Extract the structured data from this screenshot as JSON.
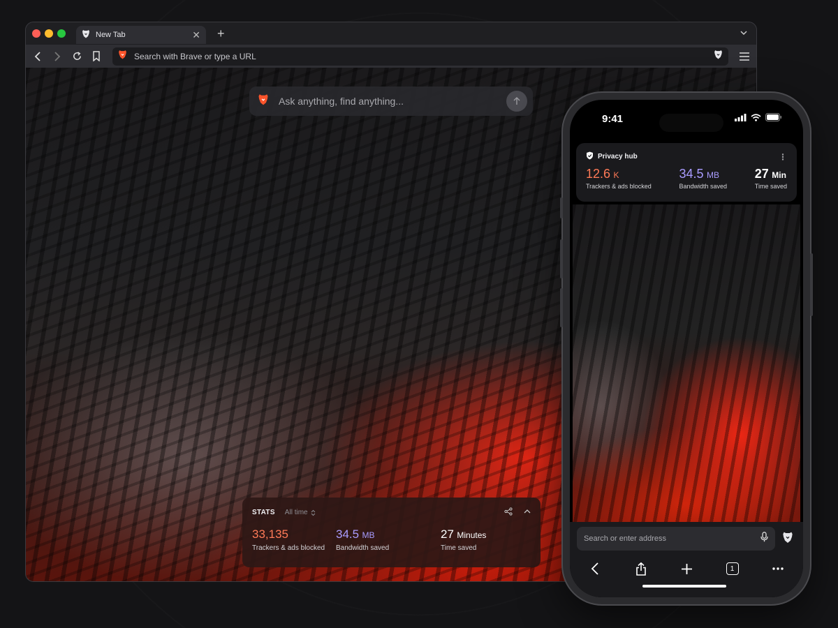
{
  "browser": {
    "tab": {
      "title": "New Tab"
    },
    "urlbar": {
      "placeholder": "Search with Brave or type a URL"
    },
    "ask": {
      "placeholder": "Ask anything, find anything..."
    },
    "stats": {
      "title": "STATS",
      "range": "All time",
      "trackers": {
        "value": "33,135",
        "label": "Trackers & ads blocked"
      },
      "bandwidth": {
        "value": "34.5",
        "unit": "MB",
        "label": "Bandwidth saved"
      },
      "time": {
        "value": "27",
        "unit": "Minutes",
        "label": "Time saved"
      }
    }
  },
  "phone": {
    "status": {
      "time": "9:41"
    },
    "privacy_hub": {
      "title": "Privacy hub",
      "trackers": {
        "value": "12.6",
        "unit": "K",
        "label": "Trackers & ads blocked"
      },
      "bandwidth": {
        "value": "34.5",
        "unit": "MB",
        "label": "Bandwidth saved"
      },
      "time": {
        "value": "27",
        "unit": "Min",
        "label": "Time saved"
      }
    },
    "address": {
      "placeholder": "Search or enter address"
    },
    "tab_count": "1"
  },
  "colors": {
    "accent_orange": "#ff7a57",
    "accent_purple": "#a99cff",
    "brave_orange": "#fb542b"
  }
}
